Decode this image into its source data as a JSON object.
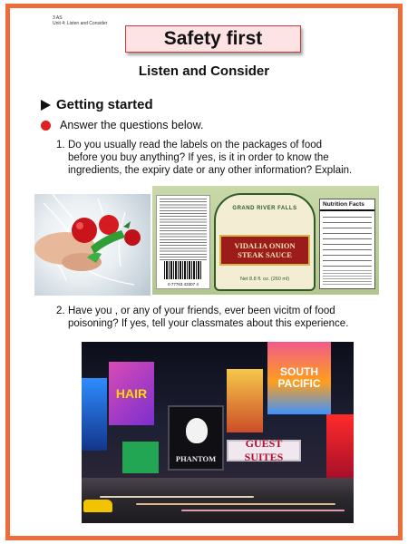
{
  "page": {
    "code_line1": "3 AS",
    "code_line2": "Unit 4: Listen and Consider",
    "title": "Safety first",
    "subtitle": "Listen and Consider",
    "section_heading": "Getting started",
    "instruction": "Answer the questions below.",
    "q1": {
      "num": "1.",
      "line1": "Do you usually read the labels on the packages of food",
      "line2": "before you buy anything? If yes, is it in order to know the",
      "line3": "ingredients, the expiry date or any other information? Explain."
    },
    "q2": {
      "num": "2.",
      "line1": "Have you , or any of your friends, ever been vicitm of food",
      "line2": "poisoning? If yes, tell your classmates about this experience."
    }
  },
  "label_image": {
    "brand": "GRAND RIVER FALLS",
    "product_line1": "VIDALIA ONION",
    "product_line2": "STEAK SAUCE",
    "net_weight": "Net 8.8 fl. oz. (260 ml)",
    "nutrition_title": "Nutrition Facts",
    "barcode_number": "0 77763 43307 4"
  },
  "city_image": {
    "sign_hair": "HAIR",
    "sign_phantom": "PHANTOM",
    "sign_south_1": "SOUTH",
    "sign_south_2": "PACIFIC",
    "sign_guest": "GUEST SUITES"
  },
  "colors": {
    "frame": "#ee6c3a",
    "title_fill": "#fde3e3",
    "title_border": "#cc3b3b",
    "bullet": "#e02020"
  }
}
